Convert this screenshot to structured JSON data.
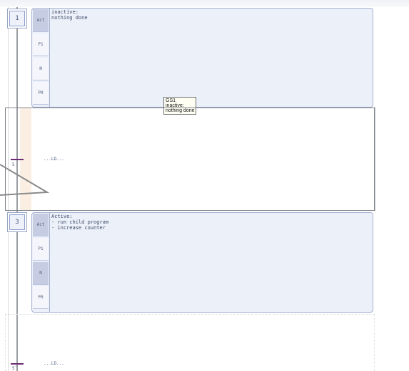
{
  "steps": [
    {
      "number": "1",
      "qualifiers": [
        "Act",
        "P1",
        "N",
        "P0"
      ],
      "action_text": "inactive:\nnothing done"
    },
    {
      "number": "3",
      "qualifiers": [
        "Act",
        "P1",
        "N",
        "P0"
      ],
      "action_text": "Active:\n- run child program\n- increase counter"
    }
  ],
  "transitions": [
    {
      "label": "5",
      "body": "...LD..."
    },
    {
      "label": "5̄",
      "body": "...LD..."
    }
  ],
  "tooltip": {
    "name": "GS1",
    "line1": "inactive:",
    "line2": "nothing done"
  },
  "colors": {
    "action_bg": "#ecf0f8",
    "action_border": "#a6b2d2",
    "transition_tick": "#6c2a74",
    "highlight_cell": "#c6cde3"
  }
}
